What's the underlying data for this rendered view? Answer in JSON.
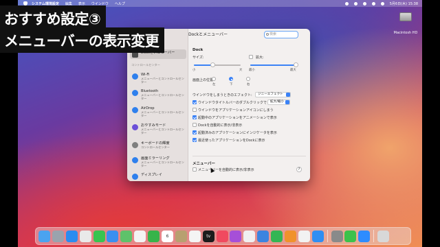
{
  "overlay": {
    "line1": "おすすめ設定③",
    "line2": "メニューバーの表示変更"
  },
  "menubar": {
    "items": [
      "システム環境設定",
      "編集",
      "表示",
      "ウインドウ",
      "ヘルプ"
    ],
    "clock": "5月6日(木) 15:38"
  },
  "desktop": {
    "hd_label": "Macintosh HD"
  },
  "window": {
    "title": "Dockとメニューバー",
    "search_placeholder": "検索",
    "sidebar": {
      "selected": "Dockとメニューバー",
      "section_label": "コントロールセンター",
      "items": [
        {
          "label": "Wi-Fi",
          "sub": "メニューバーとコントロールセンター",
          "color": "#2f80ed"
        },
        {
          "label": "Bluetooth",
          "sub": "メニューバーとコントロールセンター",
          "color": "#2f80ed"
        },
        {
          "label": "AirDrop",
          "sub": "メニューバーとコントロールセンター",
          "color": "#2f80ed"
        },
        {
          "label": "おやすみモード",
          "sub": "メニューバーとコントロールセンター",
          "color": "#6b4fd8"
        },
        {
          "label": "キーボードの輝度",
          "sub": "コントロールセンター",
          "color": "#7f7f7f"
        },
        {
          "label": "画面ミラーリング",
          "sub": "メニューバーとコントロールセンター",
          "color": "#2f80ed"
        },
        {
          "label": "ディスプレイ",
          "sub": "",
          "color": "#2f80ed"
        }
      ]
    },
    "dock": {
      "heading": "Dock",
      "size_label": "サイズ:",
      "size_min": "小",
      "size_max": "大",
      "size_value": 0.4,
      "magnify_label": "拡大:",
      "magnify_min": "最小",
      "magnify_max": "最大",
      "magnify_value": 1.0,
      "position_label": "画面上の位置:",
      "positions": [
        "左",
        "下",
        "右"
      ],
      "position_selected": "下",
      "minimize_label": "ウインドウをしまうときのエフェクト:",
      "minimize_value": "ジニーエフェクト",
      "titlebar_label": "ウインドウタイトルバーのダブルクリックで",
      "titlebar_value": "拡大/縮小",
      "checkboxes": [
        {
          "label": "ウインドウをアプリケーションアイコンにしまう",
          "checked": false
        },
        {
          "label": "起動中のアプリケーションをアニメーションで表示",
          "checked": true
        },
        {
          "label": "Dockを自動的に表示/非表示",
          "checked": false
        },
        {
          "label": "起動済みのアプリケーションにインジケータを表示",
          "checked": true
        },
        {
          "label": "最近使ったアプリケーションをDockに表示",
          "checked": true
        }
      ]
    },
    "menubar_section": {
      "heading": "メニューバー",
      "autohide_label": "メニューバーを自動的に表示/非表示",
      "autohide_checked": false
    },
    "help": "?"
  },
  "dock_apps": [
    {
      "name": "finder",
      "color": "#4aa3f0",
      "label": ""
    },
    {
      "name": "launchpad",
      "color": "#9aa3ad",
      "label": ""
    },
    {
      "name": "safari",
      "color": "#2a8cf0",
      "label": ""
    },
    {
      "name": "chrome",
      "color": "#e9e9e9",
      "label": ""
    },
    {
      "name": "messages",
      "color": "#38c44f",
      "label": ""
    },
    {
      "name": "mail",
      "color": "#3a8ff0",
      "label": ""
    },
    {
      "name": "maps",
      "color": "#5ec26a",
      "label": ""
    },
    {
      "name": "photos",
      "color": "#f3f3f3",
      "label": ""
    },
    {
      "name": "facetime",
      "color": "#37b34a",
      "label": ""
    },
    {
      "name": "calendar",
      "color": "#ffffff",
      "label": "6"
    },
    {
      "name": "notes",
      "color": "#b8a070",
      "label": ""
    },
    {
      "name": "reminders",
      "color": "#f4f4f4",
      "label": ""
    },
    {
      "name": "tv",
      "color": "#1c1c1c",
      "label": "tv"
    },
    {
      "name": "music",
      "color": "#f04a5f",
      "label": ""
    },
    {
      "name": "podcasts",
      "color": "#a64fd8",
      "label": ""
    },
    {
      "name": "news",
      "color": "#f0f0f0",
      "label": ""
    },
    {
      "name": "keynote",
      "color": "#3b84e0",
      "label": ""
    },
    {
      "name": "numbers",
      "color": "#34b654",
      "label": ""
    },
    {
      "name": "pages",
      "color": "#f0922c",
      "label": ""
    },
    {
      "name": "slack",
      "color": "#f2f2f2",
      "label": ""
    },
    {
      "name": "app-store",
      "color": "#2f8ef2",
      "label": ""
    },
    {
      "name": "system-preferences",
      "color": "#8a8a8a",
      "label": ""
    },
    {
      "name": "line",
      "color": "#3cc24b",
      "label": ""
    },
    {
      "name": "zoom",
      "color": "#2d8cff",
      "label": ""
    },
    {
      "name": "trash",
      "color": "#d8d8d8",
      "label": ""
    }
  ],
  "colors": {
    "accent": "#3b82f6",
    "overlay_bg": "#111111"
  }
}
